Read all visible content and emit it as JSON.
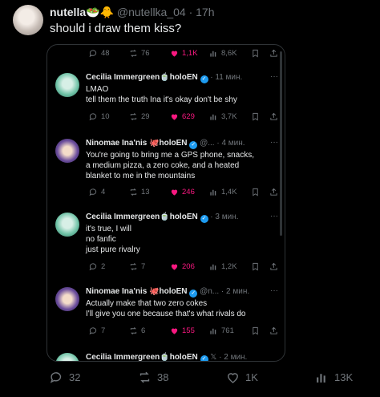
{
  "outer": {
    "author_name": "nutella🥗🐥",
    "handle": "@nutellka_04",
    "time": "· 17h",
    "text": "should i draw them kiss?",
    "stats": {
      "replies": "32",
      "reposts": "38",
      "likes": "1K",
      "views": "13K"
    }
  },
  "top_actions": {
    "replies": "48",
    "reposts": "76",
    "likes": "1,1K",
    "views": "8,6K"
  },
  "replies": [
    {
      "name": "Cecilia Immergreen🍵holoEN",
      "meta": "· 11 мин.",
      "lines": [
        "LMAO",
        "tell them the truth Ina it's okay don't be shy"
      ],
      "stats": {
        "replies": "10",
        "reposts": "29",
        "likes": "629",
        "views": "3,7K"
      }
    },
    {
      "name": "Ninomae Ina'nis 🐙holoEN",
      "meta": "@... · 4 мин.",
      "lines": [
        "You're going to bring me a GPS phone, snacks,",
        "a medium pizza, a zero coke, and a heated",
        "blanket to me in the mountains"
      ],
      "stats": {
        "replies": "4",
        "reposts": "13",
        "likes": "246",
        "views": "1,4K"
      }
    },
    {
      "name": "Cecilia Immergreen🍵holoEN",
      "meta": "· 3 мин.",
      "lines": [
        "it's true, I will",
        "no fanfic",
        "just pure rivalry"
      ],
      "stats": {
        "replies": "2",
        "reposts": "7",
        "likes": "206",
        "views": "1,2K"
      }
    },
    {
      "name": "Ninomae Ina'nis 🐙holoEN",
      "meta": "@n... · 2 мин.",
      "lines": [
        "Actually make that two zero cokes",
        "I'll give you one because that's what rivals do"
      ],
      "stats": {
        "replies": "7",
        "reposts": "6",
        "likes": "155",
        "views": "761"
      }
    },
    {
      "name": "Cecilia Immergreen🍵holoEN",
      "meta": "𝕏 · 2 мин.",
      "lines": [],
      "stats": {}
    }
  ],
  "colors": {
    "like": "#f91880",
    "verified": "#1d9bf0",
    "muted": "#71767b"
  }
}
